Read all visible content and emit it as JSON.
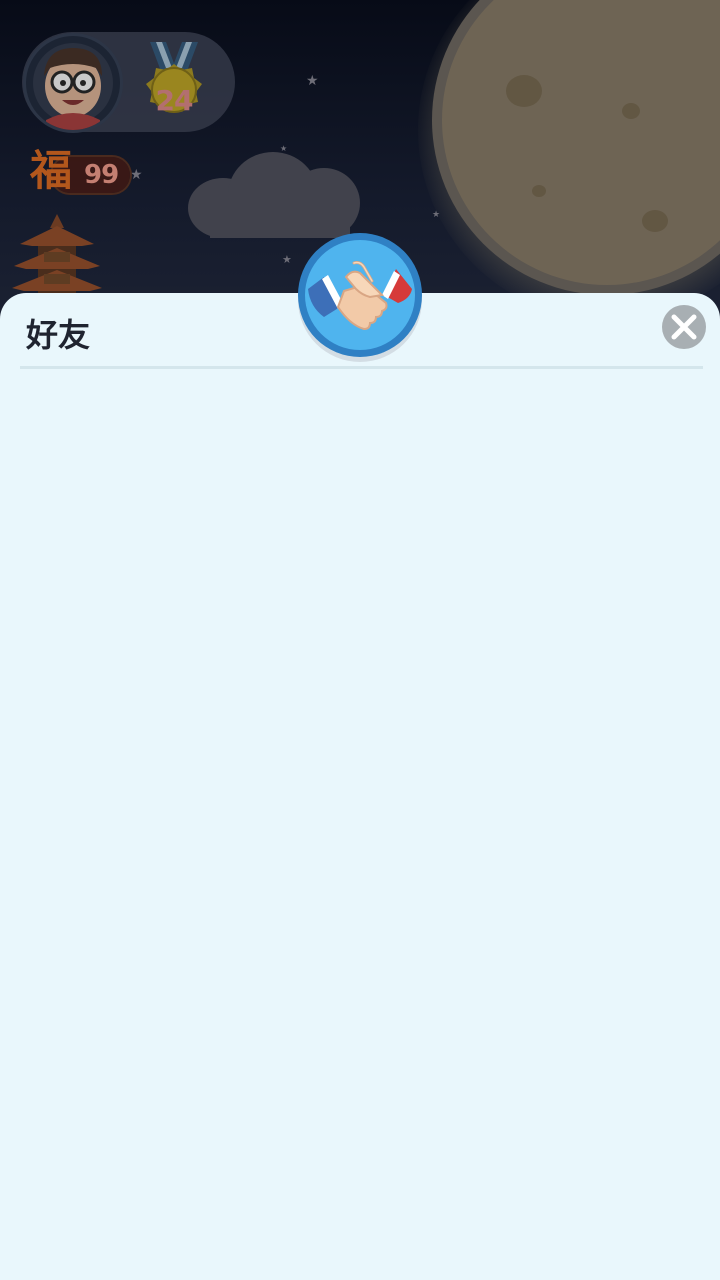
{
  "hud": {
    "level": "24",
    "fu_char": "福",
    "fu_count": "99"
  },
  "friends_panel": {
    "title": "好友"
  },
  "colors": {
    "panel_bg": "#e9f7fc",
    "badge_blue": "#2f80c4",
    "close_grey": "#a8afb3"
  }
}
